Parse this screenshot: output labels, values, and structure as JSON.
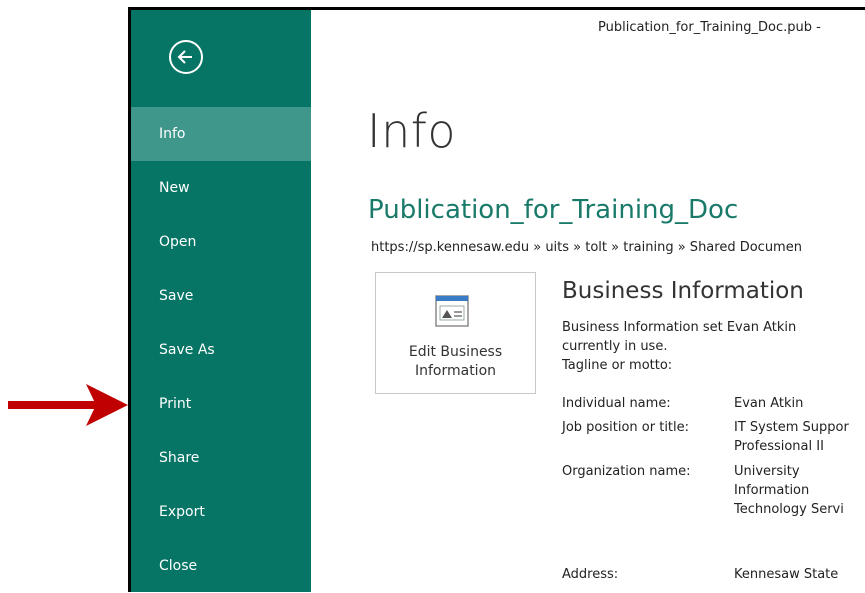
{
  "window": {
    "title": "Publication_for_Training_Doc.pub -"
  },
  "sidebar": {
    "back_icon": "back-arrow-icon",
    "items": [
      {
        "label": "Info",
        "active": true
      },
      {
        "label": "New"
      },
      {
        "label": "Open"
      },
      {
        "label": "Save"
      },
      {
        "label": "Save As"
      },
      {
        "label": "Print"
      },
      {
        "label": "Share"
      },
      {
        "label": "Export"
      },
      {
        "label": "Close"
      }
    ]
  },
  "main": {
    "page_title": "Info",
    "doc_title": "Publication_for_Training_Doc",
    "doc_path": "https://sp.kennesaw.edu » uits » tolt » training » Shared Documen",
    "edit_card": {
      "icon": "business-info-icon",
      "label_line1": "Edit Business",
      "label_line2": "Information"
    },
    "business_info": {
      "heading": "Business Information",
      "desc_line1": "Business Information set Evan Atkin",
      "desc_line2": "currently in use.",
      "tagline_label": "Tagline or motto:",
      "rows": [
        {
          "label": "Individual name:",
          "value_lines": [
            "Evan Atkin"
          ]
        },
        {
          "label": "Job position or title:",
          "value_lines": [
            "IT System Suppor",
            "Professional II"
          ]
        },
        {
          "label": "Organization name:",
          "value_lines": [
            "University",
            "Information",
            "Technology Servi"
          ]
        },
        {
          "label": "Address:",
          "value_lines": [
            "Kennesaw State"
          ]
        }
      ]
    }
  },
  "annotation": {
    "arrow_color": "#c00000"
  },
  "colors": {
    "sidebar_bg": "#077566",
    "sidebar_active": "#3f978b",
    "doc_title": "#197a6a"
  }
}
